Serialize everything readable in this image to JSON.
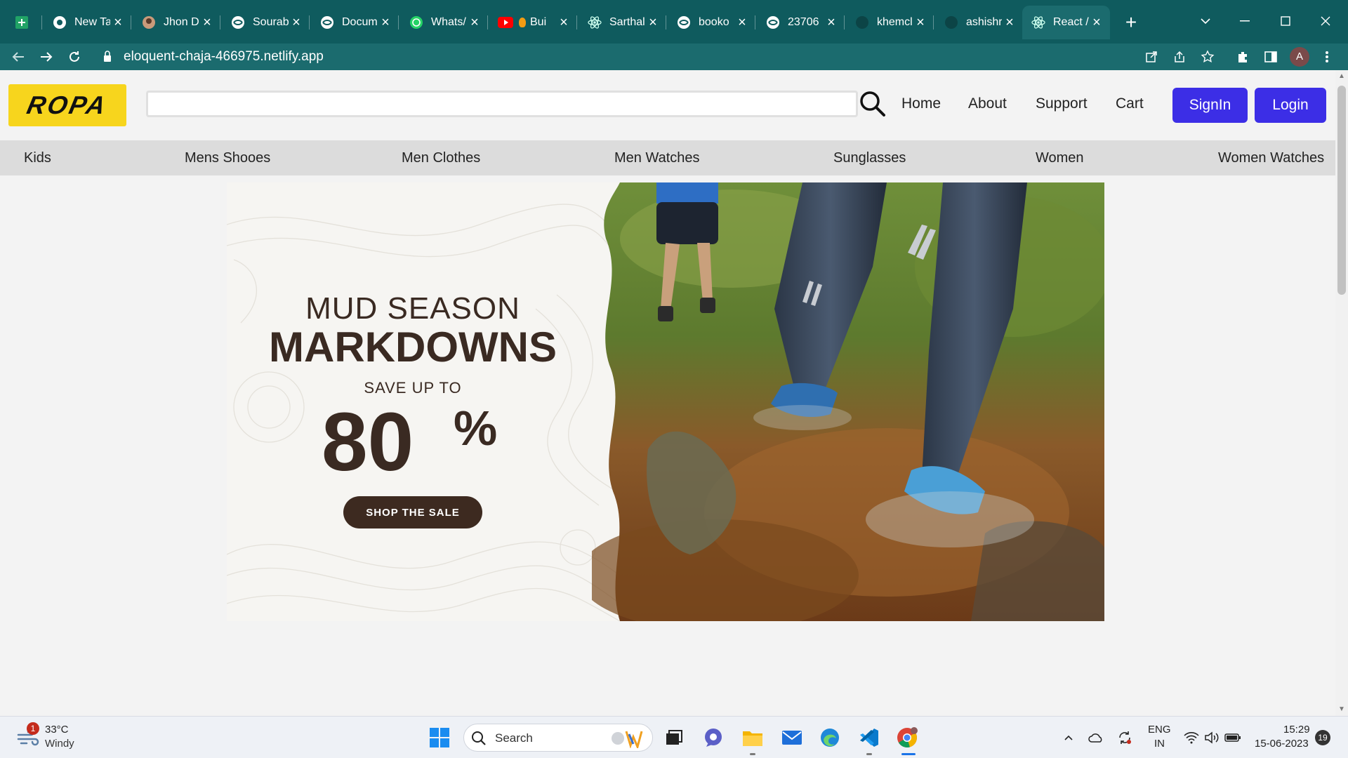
{
  "browser": {
    "tabs": [
      {
        "title": "",
        "icon": "sheets-icon",
        "active": false
      },
      {
        "title": "New Ta",
        "icon": "chrome-icon",
        "active": false
      },
      {
        "title": "Jhon D",
        "icon": "avatar-icon",
        "active": false
      },
      {
        "title": "Sourab",
        "icon": "globe-icon",
        "active": false
      },
      {
        "title": "Docum",
        "icon": "globe-icon",
        "active": false
      },
      {
        "title": "Whats/",
        "icon": "whatsapp-icon",
        "active": false
      },
      {
        "title": "Bui",
        "icon": "youtube-icon",
        "active": false
      },
      {
        "title": "Sarthal",
        "icon": "react-icon",
        "active": false
      },
      {
        "title": "booko",
        "icon": "globe-icon",
        "active": false
      },
      {
        "title": "23706",
        "icon": "globe-icon",
        "active": false
      },
      {
        "title": "khemcl",
        "icon": "github-icon",
        "active": false
      },
      {
        "title": "ashishr",
        "icon": "github-icon",
        "active": false
      },
      {
        "title": "React /",
        "icon": "react-icon",
        "active": true
      }
    ],
    "url": "eloquent-chaja-466975.netlify.app",
    "profile_initial": "A"
  },
  "site": {
    "logo_text": "ROPA",
    "search_value": "",
    "nav": [
      "Home",
      "About",
      "Support",
      "Cart"
    ],
    "signin_label": "SignIn",
    "login_label": "Login",
    "categories": [
      "Kids",
      "Mens Shooes",
      "Men Clothes",
      "Men Watches",
      "Sunglasses",
      "Women",
      "Women Watches"
    ]
  },
  "hero": {
    "title_line1": "MUD SEASON",
    "title_line2": "MARKDOWNS",
    "save_text": "SAVE UP TO",
    "discount_number": "80",
    "discount_symbol": "%",
    "cta_label": "SHOP THE SALE"
  },
  "taskbar": {
    "weather_temp": "33°C",
    "weather_condition": "Windy",
    "weather_badge": "1",
    "search_label": "Search",
    "lang_line1": "ENG",
    "lang_line2": "IN",
    "time": "15:29",
    "date": "15-06-2023",
    "notifications": "19"
  },
  "colors": {
    "browser_frame": "#0f5b5e",
    "logo_bg": "#f7d51d",
    "button_primary": "#3c2ee6",
    "hero_text": "#3a2a22"
  }
}
